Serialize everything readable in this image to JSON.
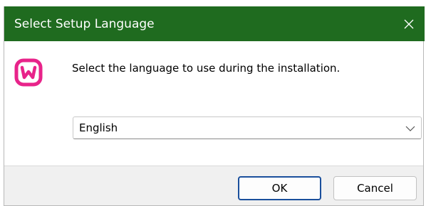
{
  "window": {
    "title": "Select Setup Language",
    "titlebar_color": "#1f6b1f",
    "close_icon": "close-icon"
  },
  "content": {
    "app_icon": "wampserver-logo-icon",
    "app_icon_color": "#e8238a",
    "message": "Select the language to use during the installation."
  },
  "language_select": {
    "selected": "English",
    "chevron_icon": "chevron-down-icon"
  },
  "buttons": {
    "ok_label": "OK",
    "cancel_label": "Cancel"
  }
}
